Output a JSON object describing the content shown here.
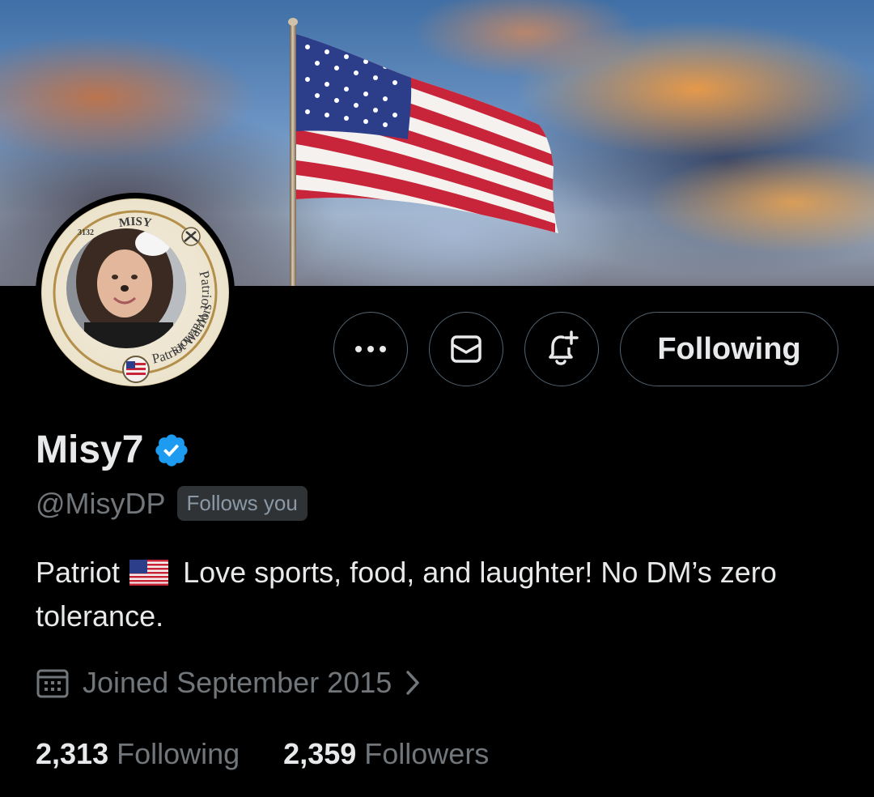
{
  "profile": {
    "display_name": "Misy7",
    "handle": "@MisyDP",
    "follows_you_label": "Follows you",
    "bio_part1": "Patriot",
    "bio_part2": "Love sports, food, and laughter! No DM’s zero tolerance.",
    "joined": "Joined September 2015",
    "following_count": "2,313",
    "following_label": "Following",
    "followers_count": "2,359",
    "followers_label": "Followers"
  },
  "avatar": {
    "badge_top": "MISY",
    "badge_number": "3132",
    "badge_left": "Patriot Warriors",
    "badge_right": "Patriot Warriors"
  },
  "actions": {
    "following_button_label": "Following"
  },
  "icons": {
    "more": "more-dots-icon",
    "message": "envelope-icon",
    "notify": "bell-plus-icon",
    "verified": "verified-badge-icon",
    "calendar": "calendar-icon",
    "chevron": "chevron-right-icon"
  },
  "colors": {
    "background": "#000000",
    "verified_blue": "#1d9bf0",
    "text_primary": "#e7e9ea",
    "text_secondary": "#71767b",
    "border": "#536471"
  }
}
